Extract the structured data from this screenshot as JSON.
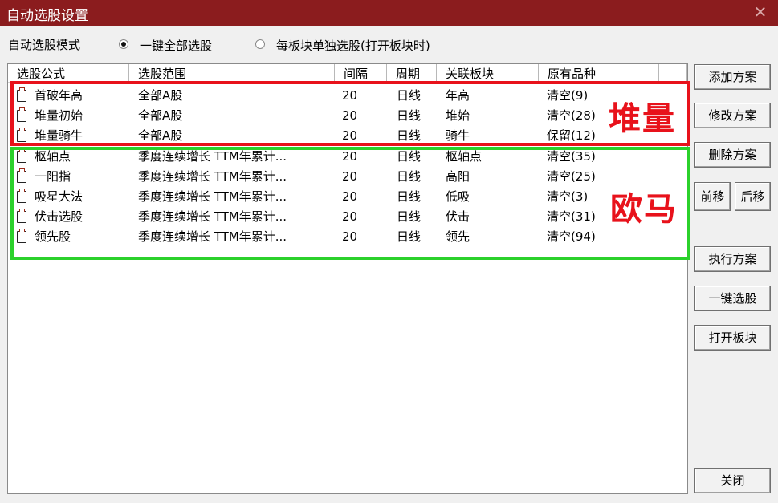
{
  "window": {
    "title": "自动选股设置",
    "close_glyph": "✕"
  },
  "mode": {
    "label": "自动选股模式",
    "options": [
      {
        "label": "一键全部选股",
        "checked": true
      },
      {
        "label": "每板块单独选股(打开板块时)",
        "checked": false
      }
    ]
  },
  "table": {
    "columns": [
      "选股公式",
      "选股范围",
      "间隔",
      "周期",
      "关联板块",
      "原有品种"
    ],
    "rows": [
      {
        "name": "首破年高",
        "range": "全部A股",
        "interval": "20",
        "period": "日线",
        "board": "年高",
        "original": "清空(9)"
      },
      {
        "name": "堆量初始",
        "range": "全部A股",
        "interval": "20",
        "period": "日线",
        "board": "堆始",
        "original": "清空(28)"
      },
      {
        "name": "堆量骑牛",
        "range": "全部A股",
        "interval": "20",
        "period": "日线",
        "board": "骑牛",
        "original": "保留(12)"
      },
      {
        "name": "枢轴点",
        "range": "季度连续增长 TTM年累计...",
        "interval": "20",
        "period": "日线",
        "board": "枢轴点",
        "original": "清空(35)"
      },
      {
        "name": "一阳指",
        "range": "季度连续增长 TTM年累计...",
        "interval": "20",
        "period": "日线",
        "board": "高阳",
        "original": "清空(25)"
      },
      {
        "name": "吸星大法",
        "range": "季度连续增长 TTM年累计...",
        "interval": "20",
        "period": "日线",
        "board": "低吸",
        "original": "清空(3)"
      },
      {
        "name": "伏击选股",
        "range": "季度连续增长 TTM年累计...",
        "interval": "20",
        "period": "日线",
        "board": "伏击",
        "original": "清空(31)"
      },
      {
        "name": "领先股",
        "range": "季度连续增长 TTM年累计...",
        "interval": "20",
        "period": "日线",
        "board": "领先",
        "original": "清空(94)"
      }
    ]
  },
  "annotations": {
    "red_label": "堆量",
    "green_label": "欧马",
    "red_color": "#e8121b",
    "green_color": "#2bd12b"
  },
  "buttons": {
    "add": "添加方案",
    "edit": "修改方案",
    "delete": "删除方案",
    "move_up": "前移",
    "move_down": "后移",
    "execute": "执行方案",
    "one_click": "一键选股",
    "open_board": "打开板块",
    "close": "关闭"
  },
  "colors": {
    "titlebar": "#8b1c1e"
  }
}
